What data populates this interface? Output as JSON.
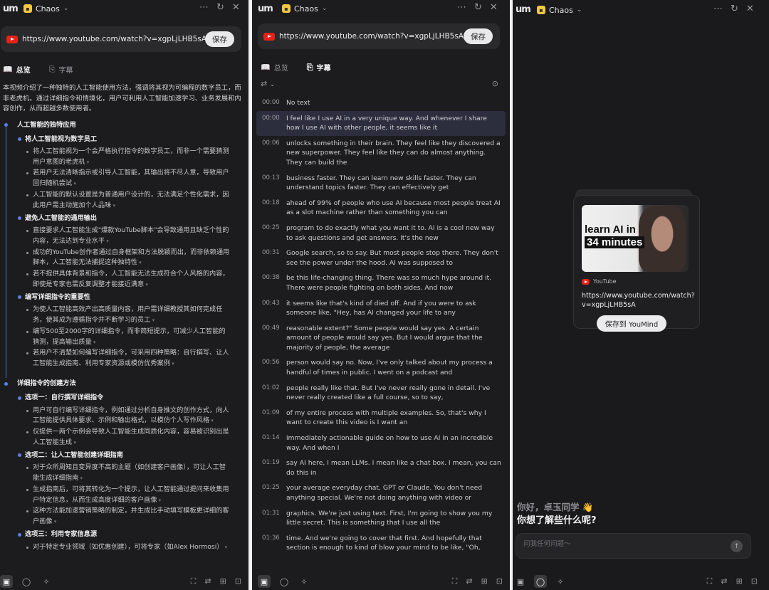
{
  "workspace": "Chaos",
  "logo_text": "um",
  "url": "https://www.youtube.com/watch?v=xgpLjLHB5sA",
  "save_label": "保存",
  "tabs": {
    "overview": "总览",
    "subtitles": "字幕"
  },
  "summary": "本视频介绍了一种独特的人工智能使用方法，强调将其视为可编程的数字员工，而非老虎机。通过详细指令和情境化，用户可利用人工智能加速学习、业务发展和内容创作，从而超越多数使用者。",
  "outline": [
    {
      "title": "人工智能的独特应用",
      "sections": [
        {
          "title": "将人工智能视为数字员工",
          "items": [
            "将人工智能视为一个会严格执行指令的数字员工，而非一个需要猜测用户意图的老虎机",
            "若用户无法清晰指示或引导人工智能，其输出将不尽人意，导致用户回归随机尝试",
            "人工智能的默认设置是为普通用户设计的，无法满足个性化需求，因此用户需主动施加个人品味"
          ]
        },
        {
          "title": "避免人工智能的通用输出",
          "items": [
            "直接要求人工智能生成\"爆款YouTube脚本\"会导致通用且缺乏个性的内容，无法达到专业水平",
            "成功的YouTube创作者通过自身框架和方法脱颖而出，而非依赖通用脚本，人工智能无法捕捉这种独特性",
            "若不提供具体背景和指令，人工智能无法生成符合个人风格的内容，即使是专家也需反复调整才能接近满意"
          ]
        },
        {
          "title": "编写详细指令的重要性",
          "items": [
            "为使人工智能高效产出高质量内容，用户需详细教授其如何完成任务，使其成为遵循指令并不断学习的员工",
            "编写500至2000字的详细指令，而非简短提示，可减少人工智能的猜测，提高输出质量",
            "若用户不清楚如何编写详细指令，可采用四种策略：自行撰写、让人工智能生成指南、利用专家资源或模仿优秀案例"
          ]
        }
      ]
    },
    {
      "title": "详细指令的创建方法",
      "sections": [
        {
          "title": "选项一：自行撰写详细指令",
          "items": [
            "用户可自行编写详细指令，例如通过分析自身推文的创作方式，向人工智能提供具体要求、示例和输出格式，以模仿个人写作风格",
            "仅提供一两个示例会导致人工智能生成同质化内容，容易被识别出是人工智能生成"
          ]
        },
        {
          "title": "选项二：让人工智能创建详细指南",
          "items": [
            "对于众所周知且变异度不高的主题（如创建客户画像），可让人工智能生成详细指南",
            "生成指南后，可将其转化为一个提示，让人工智能通过提问来收集用户特定信息，从而生成高度详细的客户画像",
            "这种方法能加速营销策略的制定，并生成比手动填写模板更详细的客户画像"
          ]
        },
        {
          "title": "选项三：利用专家信息源",
          "items": [
            "对于特定专业领域（如优惠创建），可将专家（如Alex Hormosi）"
          ]
        }
      ]
    }
  ],
  "transcript": [
    {
      "t": "00:00",
      "text": "No text"
    },
    {
      "t": "00:00",
      "text": "I feel like I use AI in a very unique way. And whenever I share how I use AI with other people, it seems like it",
      "active": true
    },
    {
      "t": "00:06",
      "text": "unlocks something in their brain. They feel like they discovered a new superpower. They feel like they can do almost anything. They can build the"
    },
    {
      "t": "00:13",
      "text": "business faster. They can learn new skills faster. They can understand topics faster. They can effectively get"
    },
    {
      "t": "00:18",
      "text": "ahead of 99% of people who use AI because most people treat AI as a slot machine rather than something you can"
    },
    {
      "t": "00:25",
      "text": "program to do exactly what you want it to. AI is a cool new way to ask questions and get answers. It's the new"
    },
    {
      "t": "00:31",
      "text": "Google search, so to say. But most people stop there. They don't see the power under the hood. AI was supposed to"
    },
    {
      "t": "00:38",
      "text": "be this life-changing thing. There was so much hype around it. There were people fighting on both sides. And now"
    },
    {
      "t": "00:43",
      "text": "it seems like that's kind of died off. And if you were to ask someone like, \"Hey, has AI changed your life to any"
    },
    {
      "t": "00:49",
      "text": "reasonable extent?\" Some people would say yes. A certain amount of people would say yes. But I would argue that the majority of people, the average"
    },
    {
      "t": "00:56",
      "text": "person would say no. Now, I've only talked about my process a handful of times in public. I went on a podcast and"
    },
    {
      "t": "01:02",
      "text": "people really like that. But I've never really gone in detail. I've never really created like a full course, so to say,"
    },
    {
      "t": "01:09",
      "text": "of my entire process with multiple examples. So, that's why I want to create this video is I want an"
    },
    {
      "t": "01:14",
      "text": "immediately actionable guide on how to use AI in an incredible way. And when I"
    },
    {
      "t": "01:19",
      "text": "say AI here, I mean LLMs. I mean like a chat box. I mean, you can do this in"
    },
    {
      "t": "01:25",
      "text": "your average everyday chat, GPT or Claude. You don't need anything special. We're not doing anything with video or"
    },
    {
      "t": "01:31",
      "text": "graphics. We're just using text. First, I'm going to show you my little secret. This is something that I use all the"
    },
    {
      "t": "01:36",
      "text": "time. And we're going to cover that first. And hopefully that section is enough to kind of blow your mind to be like, \"Oh,"
    }
  ],
  "card": {
    "thumb_line1": "learn AI in",
    "thumb_line2": "34 minutes",
    "source": "YouTube",
    "url": "https://www.youtube.com/watch?v=xgpLjLHB5sA",
    "save_button": "保存到 YouMind"
  },
  "chat": {
    "greeting": "你好，卓玉同学 👋",
    "question": "你想了解些什么呢?",
    "placeholder": "问我任何问题～"
  },
  "colors": {
    "bg": "#1c1c1e",
    "accent": "#4b6fd9",
    "highlight": "#2c2d3d",
    "youtube": "#e62117"
  }
}
